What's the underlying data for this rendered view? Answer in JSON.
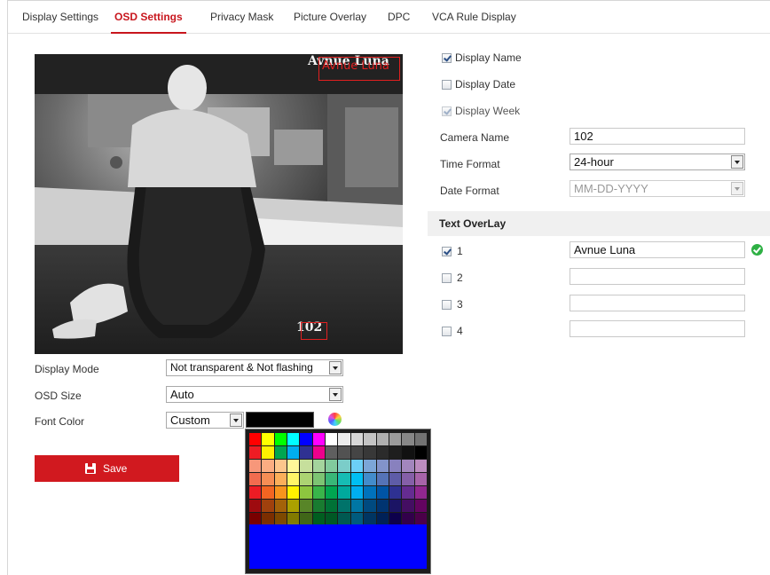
{
  "tabs": [
    {
      "label": "Display Settings",
      "active": false
    },
    {
      "label": "OSD Settings",
      "active": true
    },
    {
      "label": "Privacy Mask",
      "active": false
    },
    {
      "label": "Picture Overlay",
      "active": false
    },
    {
      "label": "DPC",
      "active": false
    },
    {
      "label": "VCA Rule Display",
      "active": false
    }
  ],
  "preview": {
    "osd_name_white": "Avnue Luna",
    "osd_name_red": "Avnue Luna",
    "osd_camera_number": "102"
  },
  "display_options": {
    "display_name": {
      "label": "Display Name",
      "checked": true
    },
    "display_date": {
      "label": "Display Date",
      "checked": false
    },
    "display_week": {
      "label": "Display Week",
      "checked": true,
      "disabled": true
    }
  },
  "fields": {
    "camera_name": {
      "label": "Camera Name",
      "value": "102"
    },
    "time_format": {
      "label": "Time Format",
      "value": "24-hour"
    },
    "date_format": {
      "label": "Date Format",
      "value": "MM-DD-YYYY"
    }
  },
  "text_overlay": {
    "title": "Text OverLay",
    "items": [
      {
        "index": "1",
        "checked": true,
        "value": "Avnue Luna",
        "valid": true
      },
      {
        "index": "2",
        "checked": false,
        "value": ""
      },
      {
        "index": "3",
        "checked": false,
        "value": ""
      },
      {
        "index": "4",
        "checked": false,
        "value": ""
      }
    ]
  },
  "display_mode": {
    "label": "Display Mode",
    "value": "Not transparent & Not flashing"
  },
  "osd_size": {
    "label": "OSD Size",
    "value": "Auto"
  },
  "font_color": {
    "label": "Font Color",
    "value": "Custom",
    "current_color": "#000000"
  },
  "palette": {
    "selected_color": "#0000ff",
    "rows": [
      [
        "#ff0000",
        "#ffff00",
        "#00ff00",
        "#00ffff",
        "#0000ff",
        "#ff00ff",
        "#ffffff",
        "#ebebeb",
        "#d7d7d7",
        "#c3c3c3",
        "#afafaf",
        "#9b9b9b",
        "#878787",
        "#737373"
      ],
      [
        "#ee1c24",
        "#fff100",
        "#00a650",
        "#00aeef",
        "#2f3192",
        "#ed008c",
        "#5f5f5f",
        "#525252",
        "#454545",
        "#383838",
        "#2b2b2b",
        "#1e1e1e",
        "#111111",
        "#000000"
      ],
      [
        "#f7977a",
        "#fbad82",
        "#fdc68c",
        "#fff799",
        "#c6df9c",
        "#a4d49d",
        "#81ca9d",
        "#7bcdc9",
        "#6ccff7",
        "#7ca6d8",
        "#8293ca",
        "#8881be",
        "#a286bd",
        "#bc8cbf"
      ],
      [
        "#f26c4f",
        "#f68e55",
        "#fbaf5a",
        "#fff467",
        "#acd372",
        "#7dc473",
        "#39b778",
        "#16bcb4",
        "#00bff3",
        "#438ccb",
        "#5573b7",
        "#5e5ca7",
        "#855fa8",
        "#a763a9"
      ],
      [
        "#ed1c24",
        "#f26522",
        "#f7941d",
        "#fff200",
        "#8dc63f",
        "#39b54a",
        "#00a651",
        "#00a99d",
        "#00aeef",
        "#0072bc",
        "#0054a5",
        "#2e3192",
        "#652c91",
        "#91278f"
      ],
      [
        "#9e0b0f",
        "#a0410d",
        "#a36209",
        "#aba000",
        "#588528",
        "#197b30",
        "#007236",
        "#00736a",
        "#0076a4",
        "#004a80",
        "#003471",
        "#1b1464",
        "#440e62",
        "#630460"
      ],
      [
        "#790000",
        "#7b2e00",
        "#7d4900",
        "#827b00",
        "#406618",
        "#005e20",
        "#005825",
        "#005951",
        "#005b7e",
        "#003562",
        "#002157",
        "#0d004c",
        "#32004b",
        "#4b0049"
      ]
    ]
  },
  "save": {
    "label": "Save"
  }
}
